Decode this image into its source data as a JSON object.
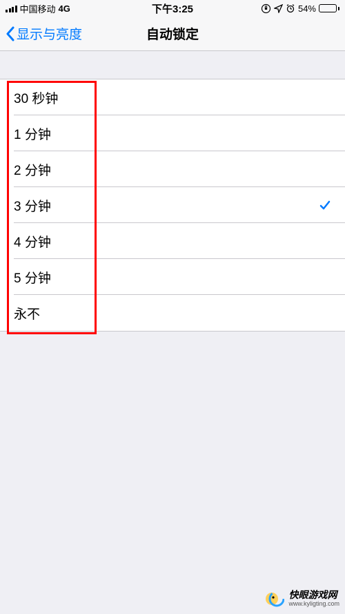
{
  "statusBar": {
    "carrier": "中国移动",
    "network": "4G",
    "time": "下午3:25",
    "batteryPercent": "54%",
    "batteryFill": 54
  },
  "nav": {
    "backLabel": "显示与亮度",
    "title": "自动锁定"
  },
  "options": [
    {
      "label": "30 秒钟",
      "selected": false
    },
    {
      "label": "1 分钟",
      "selected": false
    },
    {
      "label": "2 分钟",
      "selected": false
    },
    {
      "label": "3 分钟",
      "selected": true
    },
    {
      "label": "4 分钟",
      "selected": false
    },
    {
      "label": "5 分钟",
      "selected": false
    },
    {
      "label": "永不",
      "selected": false
    }
  ],
  "watermark": {
    "title": "快眼游戏网",
    "url": "www.kyligting.com"
  }
}
